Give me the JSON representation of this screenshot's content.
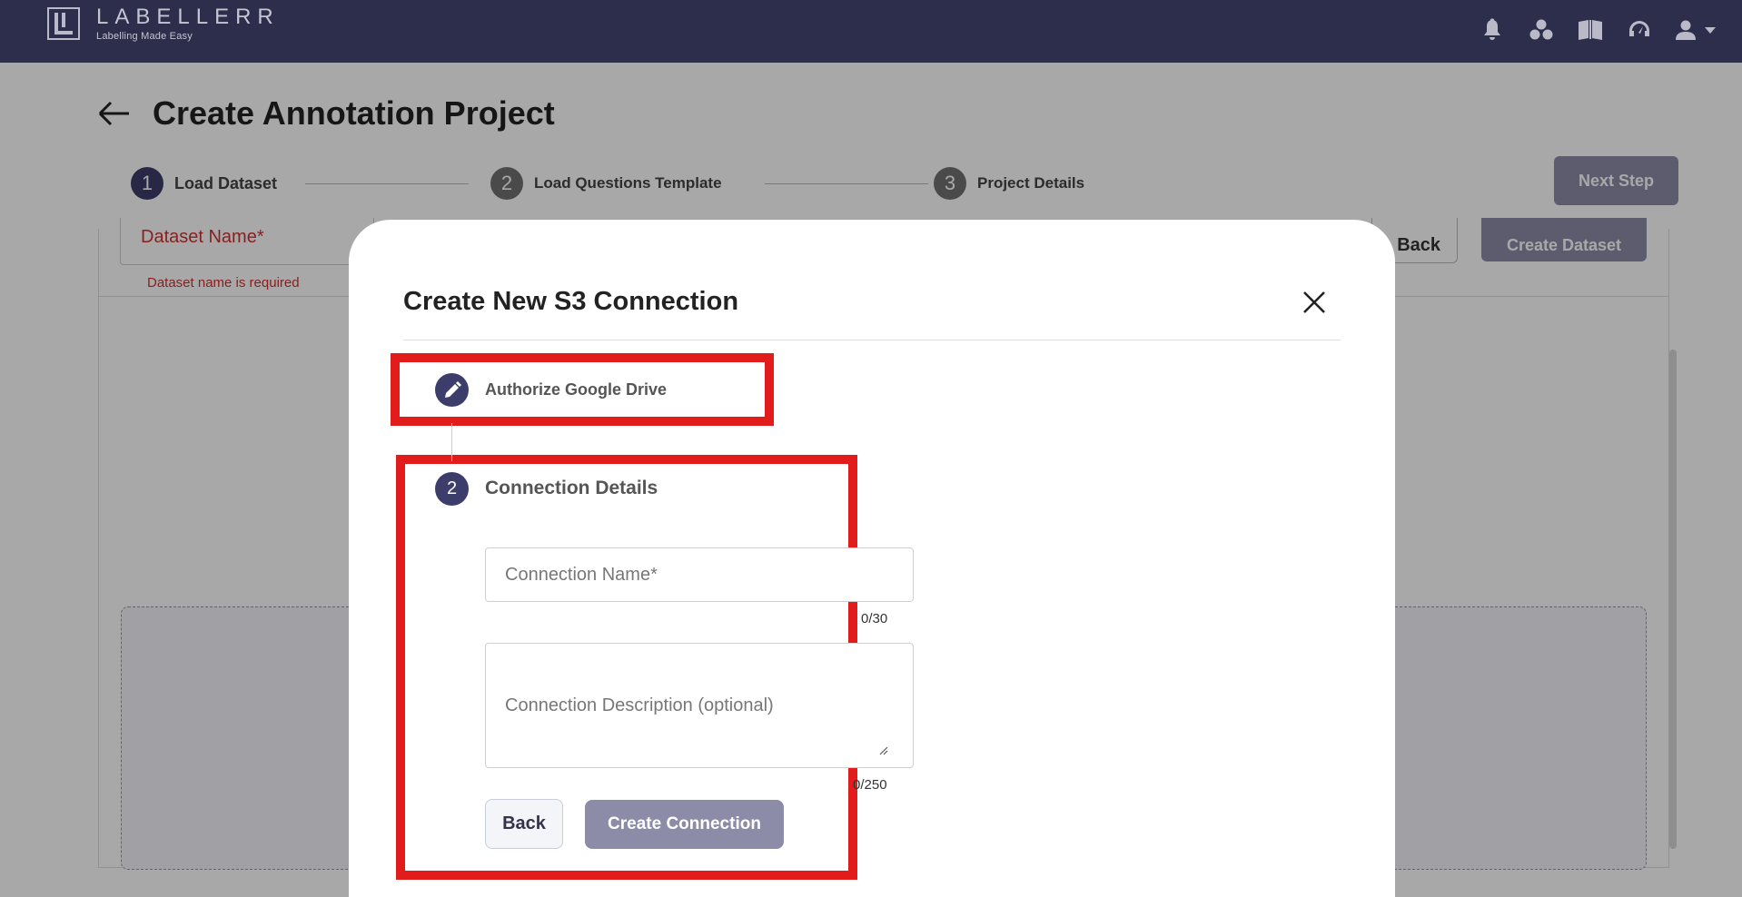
{
  "brand": {
    "name": "LABELLERR",
    "tagline": "Labelling Made Easy"
  },
  "nav": {
    "icons": [
      "bell-icon",
      "apps-icon",
      "book-icon",
      "speed-icon",
      "user-icon",
      "dropdown-arrow-icon"
    ]
  },
  "page": {
    "title": "Create Annotation Project",
    "steps": [
      {
        "num": "1",
        "label": "Load Dataset"
      },
      {
        "num": "2",
        "label": "Load Questions Template"
      },
      {
        "num": "3",
        "label": "Project Details"
      }
    ],
    "next_label": "Next Step",
    "dataset_field": {
      "label": "Dataset Name*",
      "error": "Dataset name is required"
    },
    "back_label": "Back",
    "create_dataset_label": "Create Dataset"
  },
  "modal": {
    "title": "Create New S3 Connection",
    "step1_label": "Authorize Google Drive",
    "step2_num": "2",
    "step2_label": "Connection Details",
    "name_placeholder": "Connection Name*",
    "name_counter": "0/30",
    "desc_placeholder": "Connection Description (optional)",
    "desc_counter": "0/250",
    "back_label": "Back",
    "create_label": "Create Connection"
  },
  "colors": {
    "nav_bg": "#2d2d4c",
    "accent": "#3d3d6b",
    "disabled_button": "#8c8ca8",
    "highlight": "#e21b1b",
    "error": "#d32f2f"
  }
}
